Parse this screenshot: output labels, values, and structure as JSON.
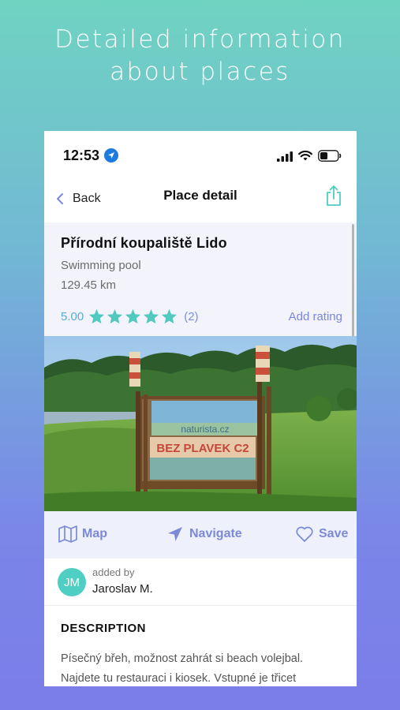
{
  "promo": {
    "line1": "Detailed information",
    "line2": "about places"
  },
  "status_bar": {
    "time": "12:53"
  },
  "navbar": {
    "back_label": "Back",
    "title": "Place detail"
  },
  "place": {
    "name": "Přírodní koupaliště Lido",
    "category": "Swimming pool",
    "distance": "129.45 km",
    "rating_value": "5.00",
    "rating_stars": 5,
    "rating_count": "(2)",
    "add_rating_label": "Add rating"
  },
  "photo": {
    "sign_text": "BEZ PLAVEK C2",
    "sign_top_text": "naturista.cz"
  },
  "actions": {
    "map_label": "Map",
    "navigate_label": "Navigate",
    "save_label": "Save"
  },
  "author": {
    "initials": "JM",
    "added_by_label": "added by",
    "name": "Jaroslav M."
  },
  "description": {
    "heading": "DESCRIPTION",
    "line1": "Písečný břeh, možnost zahrát si beach volejbal.",
    "line2": "Najdete tu restauraci i kiosek. Vstupné je třicet"
  },
  "colors": {
    "accent": "#7b86e0",
    "teal": "#4fcfc3",
    "star": "#52c9bf"
  }
}
